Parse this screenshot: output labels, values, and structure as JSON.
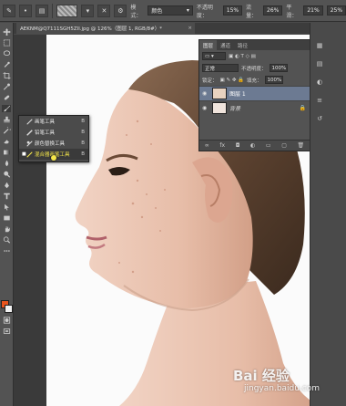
{
  "options_bar": {
    "mode_label": "模式：",
    "mode_value": "颜色",
    "opacity_label": "不透明度：",
    "opacity_value": "15%",
    "flow_label": "流量：",
    "flow_value": "26%",
    "smoothing_label": "平滑：",
    "smoothing_value": "21%",
    "angle_value": "25%"
  },
  "document_tab": {
    "title": "AEKNM@Q7111SGH5Zll.jpg @ 126%（图层 1, RGB/8#）*",
    "close": "×"
  },
  "context_menu": {
    "items": [
      {
        "label": "画笔工具",
        "shortcut": "B",
        "checked": false
      },
      {
        "label": "铅笔工具",
        "shortcut": "B",
        "checked": false
      },
      {
        "label": "颜色替换工具",
        "shortcut": "B",
        "checked": false
      },
      {
        "label": "混合器画笔工具",
        "shortcut": "B",
        "checked": true
      }
    ]
  },
  "layers_panel": {
    "tabs": [
      "图层",
      "通道",
      "路径"
    ],
    "blend_mode": "正常",
    "opacity_label": "不透明度：",
    "opacity_value": "100%",
    "lock_label": "锁定：",
    "fill_label": "填充：",
    "fill_value": "100%",
    "layers": [
      {
        "name": "图层 1",
        "selected": true,
        "italic": false
      },
      {
        "name": "背景",
        "selected": false,
        "italic": true
      }
    ]
  },
  "watermark": {
    "brand": "Bai 经验",
    "url": "jingyan.baidu.com"
  },
  "colors": {
    "foreground": "#e8541c",
    "background": "#f2f2f2",
    "highlight": "#f4e64a",
    "selected_layer": "#6c7a92"
  }
}
